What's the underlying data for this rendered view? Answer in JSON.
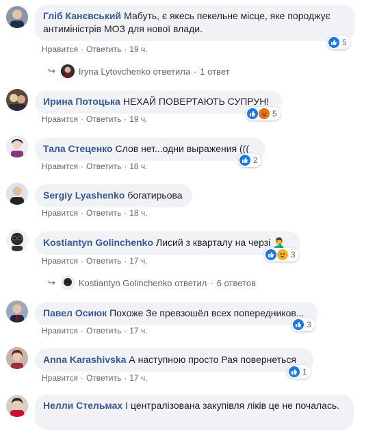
{
  "comments": [
    {
      "author": "Гліб Канєвський",
      "text": "Мабуть, є якесь пекельне місце, яке породжує антиміністрів МОЗ для нової влади.",
      "like": "Нравится",
      "reply": "Ответить",
      "time": "19 ч.",
      "reactions": [
        "like"
      ],
      "reaction_count": "5",
      "replies": {
        "name": "Iryna Lytovchenko",
        "verb": "ответила",
        "count": "1 ответ"
      }
    },
    {
      "author": "Ирина Потоцька",
      "text": "НЕХАЙ ПОВЕРТАЮТЬ СУПРУН!",
      "like": "Нравится",
      "reply": "Ответить",
      "time": "19 ч.",
      "reactions": [
        "like",
        "angry"
      ],
      "reaction_count": "5"
    },
    {
      "author": "Тала Стеценко",
      "text": "Слов нет...одни выражения (((",
      "like": "Нравится",
      "reply": "Ответить",
      "time": "18 ч.",
      "reactions": [
        "like"
      ],
      "reaction_count": "2"
    },
    {
      "author": "Sergiy Lyashenko",
      "text": "богатирьова",
      "like": "Нравится",
      "reply": "Ответить",
      "time": "18 ч."
    },
    {
      "author": "Kostiantyn Golinchenko",
      "text": "Лисий з кварталу на черзі 🤦‍♂️",
      "like": "Нравится",
      "reply": "Ответить",
      "time": "17 ч.",
      "reactions": [
        "like",
        "sad"
      ],
      "reaction_count": "3",
      "replies": {
        "name": "Kostiantyn Golinchenko",
        "verb": "ответил",
        "count": "6 ответов"
      }
    },
    {
      "author": "Павел Осиюк",
      "text": "Похоже Зе превзошёл всех попередников...",
      "like": "Нравится",
      "reply": "Ответить",
      "time": "17 ч.",
      "reactions": [
        "like"
      ],
      "reaction_count": "3"
    },
    {
      "author": "Anna Karashivska",
      "text": "А наступною просто Рая повернеться",
      "like": "Нравится",
      "reply": "Ответить",
      "time": "17 ч.",
      "reactions": [
        "like"
      ],
      "reaction_count": "1"
    },
    {
      "author": "Нелли Стельмах",
      "text": "І централізована закупівля ліків це не почалась.",
      "like": "",
      "reply": "",
      "time": ""
    }
  ],
  "colors": {
    "link": "#385898",
    "bubble": "#f0f2f5",
    "like": "#1877f2",
    "angry": "#e9710f",
    "sad": "#f7b125"
  }
}
